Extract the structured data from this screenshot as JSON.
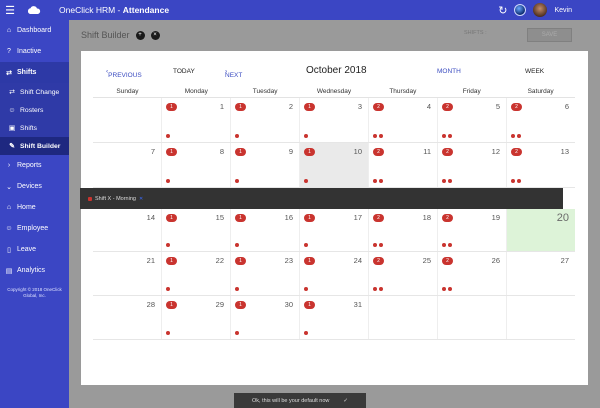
{
  "topbar": {
    "app_name": "OneClick HRM - ",
    "module": "Attendance",
    "user_name": "Kevin"
  },
  "sidebar": {
    "items": [
      {
        "label": "Dashboard",
        "icon": "house-icon"
      },
      {
        "label": "Inactive",
        "icon": "question-icon"
      },
      {
        "label": "Shifts",
        "icon": "exchange-icon"
      },
      {
        "label": "Reports",
        "icon": "chevron-right-icon"
      },
      {
        "label": "Devices",
        "icon": "chevron-down-icon"
      },
      {
        "label": "Home",
        "icon": "house-icon"
      },
      {
        "label": "Employee",
        "icon": "users-icon"
      },
      {
        "label": "Leave",
        "icon": "door-icon"
      },
      {
        "label": "Analytics",
        "icon": "chart-icon"
      }
    ],
    "sub_items": [
      {
        "label": "Shift Change"
      },
      {
        "label": "Rosters"
      },
      {
        "label": "Shifts"
      },
      {
        "label": "Shift Builder"
      }
    ],
    "copyright": "Copyright © 2018 OneClick Global, Inc."
  },
  "page": {
    "title": "Shift Builder",
    "right_label": "SHIFTS :",
    "save_label": "SAVE"
  },
  "calendar": {
    "prev_label": "PREVIOUS",
    "today_label": "TODAY",
    "next_label": "NEXT",
    "month_title": "October 2018",
    "month_view": "MONTH",
    "week_view": "WEEK",
    "weekdays": [
      "Sunday",
      "Monday",
      "Tuesday",
      "Wednesday",
      "Thursday",
      "Friday",
      "Saturday"
    ],
    "weeks": [
      [
        {
          "n": "",
          "b": "",
          "d": 0
        },
        {
          "n": "1",
          "b": "1",
          "d": 1
        },
        {
          "n": "2",
          "b": "1",
          "d": 1
        },
        {
          "n": "3",
          "b": "1",
          "d": 1
        },
        {
          "n": "4",
          "b": "2",
          "d": 2
        },
        {
          "n": "5",
          "b": "2",
          "d": 2
        },
        {
          "n": "6",
          "b": "2",
          "d": 2
        }
      ],
      [
        {
          "n": "7",
          "b": "",
          "d": 0
        },
        {
          "n": "8",
          "b": "1",
          "d": 1
        },
        {
          "n": "9",
          "b": "1",
          "d": 1
        },
        {
          "n": "10",
          "b": "1",
          "d": 1,
          "today": true
        },
        {
          "n": "11",
          "b": "2",
          "d": 2
        },
        {
          "n": "12",
          "b": "2",
          "d": 2
        },
        {
          "n": "13",
          "b": "2",
          "d": 2
        }
      ],
      [
        {
          "n": "14",
          "b": "",
          "d": 0
        },
        {
          "n": "15",
          "b": "1",
          "d": 1
        },
        {
          "n": "16",
          "b": "1",
          "d": 1
        },
        {
          "n": "17",
          "b": "1",
          "d": 1
        },
        {
          "n": "18",
          "b": "2",
          "d": 2
        },
        {
          "n": "19",
          "b": "2",
          "d": 2
        },
        {
          "n": "20",
          "b": "",
          "d": 0,
          "highlight": true
        }
      ],
      [
        {
          "n": "21",
          "b": "",
          "d": 0
        },
        {
          "n": "22",
          "b": "1",
          "d": 1
        },
        {
          "n": "23",
          "b": "1",
          "d": 1
        },
        {
          "n": "24",
          "b": "1",
          "d": 1
        },
        {
          "n": "25",
          "b": "2",
          "d": 2
        },
        {
          "n": "26",
          "b": "2",
          "d": 2
        },
        {
          "n": "27",
          "b": "",
          "d": 0
        }
      ],
      [
        {
          "n": "28",
          "b": "",
          "d": 0
        },
        {
          "n": "29",
          "b": "1",
          "d": 1
        },
        {
          "n": "30",
          "b": "1",
          "d": 1
        },
        {
          "n": "31",
          "b": "1",
          "d": 1
        },
        {
          "n": "",
          "b": "",
          "d": 0
        },
        {
          "n": "",
          "b": "",
          "d": 0
        },
        {
          "n": "",
          "b": "",
          "d": 0
        }
      ]
    ],
    "expanded_event": {
      "label": "Shift X - Morning",
      "close_label": "✕"
    }
  },
  "toast": {
    "message": "Ok, this will be your default now"
  },
  "colors": {
    "brand": "#3b46c4",
    "badge": "#c9342f",
    "highlight": "#ddf3d8"
  }
}
